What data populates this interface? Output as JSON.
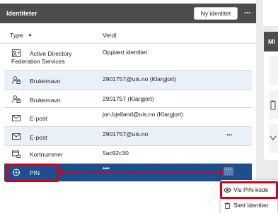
{
  "panel": {
    "title": "Identiteter",
    "new_button": "Ny identitet",
    "more": "···"
  },
  "columns": {
    "type": "Type",
    "value": "Verdi"
  },
  "rows": [
    {
      "icon": "federation-icon",
      "type_line1": "Active Directory",
      "type_line2": "Federation Services",
      "value": "Opplært identitet"
    },
    {
      "icon": "user-lock-icon",
      "type": "Brukernavn",
      "value": "2901757@uis.no (Klargjort)"
    },
    {
      "icon": "user-lock-icon",
      "type": "Brukernavn",
      "value": "2901757 (Klargjort)"
    },
    {
      "icon": "envelope-icon",
      "type": "E-post",
      "value": "jon.bjelland@uis.no (Klargjort)"
    },
    {
      "icon": "envelope-icon",
      "type": "E-post",
      "value": "2901757@uis.no",
      "more": "···"
    },
    {
      "icon": "card-lock-icon",
      "type": "Kortnummer",
      "value": "5ac92c30"
    },
    {
      "icon": "pin-icon",
      "type": "PIN",
      "value": "***",
      "more": "···"
    }
  ],
  "menu": {
    "show_pin": "Vis PIN-kode",
    "delete": "Slett identitet"
  },
  "right_panel": {
    "title": "Mi"
  },
  "colors": {
    "header_bg": "#4d4d4d",
    "selected_row": "#1f4e8c",
    "highlight": "#d0021b"
  }
}
